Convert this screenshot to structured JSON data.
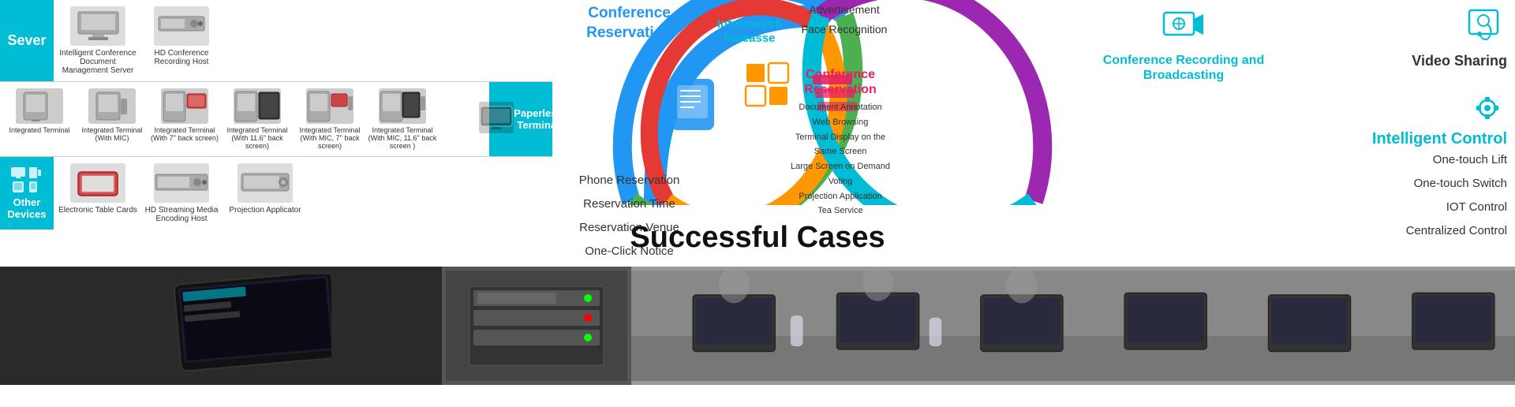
{
  "server": {
    "label": "Sever",
    "items": [
      {
        "name": "Intelligent Conference Document Management Server",
        "iconLabel": "Server"
      },
      {
        "name": "HD Conference Recording Host",
        "iconLabel": "Host"
      }
    ]
  },
  "terminals": {
    "items": [
      {
        "name": "Integrated Terminal",
        "iconLabel": "Terminal"
      },
      {
        "name": "Integrated Terminal (With MIC)",
        "iconLabel": "Terminal"
      },
      {
        "name": "Integrated Terminal (With 7'' back screen)",
        "iconLabel": "Screen"
      },
      {
        "name": "Integrated Terminal (With 11.6'' back screen)",
        "iconLabel": "Screen"
      },
      {
        "name": "Integrated Terminal (With MIC, 7'' back screen)",
        "iconLabel": "Screen"
      },
      {
        "name": "Integrated Terminal (With MIC, 11.6'' back screen )",
        "iconLabel": "Screen"
      }
    ],
    "paperless": {
      "label": "Paperless Terminal",
      "iconLabel": "Screen"
    }
  },
  "otherDevices": {
    "label": "Other Devices",
    "items": [
      {
        "name": "Electronic Table Cards",
        "iconLabel": "Card"
      },
      {
        "name": "HD Streaming Media Encoding Host",
        "iconLabel": "Host"
      },
      {
        "name": "Projection Applicator",
        "iconLabel": "Proj"
      }
    ]
  },
  "diagram": {
    "conferenceReservation": {
      "title": "Conference Reservation",
      "items": [
        "Phone Reservation",
        "Reservation Time",
        "Reservation Venue",
        "One-Click Notice"
      ]
    },
    "informationRelease": {
      "title": "Information Releasse"
    },
    "topCenter": {
      "lines": [
        "Advertisement",
        "Face Recognition"
      ]
    },
    "videoSharing": {
      "title": "Video Sharing"
    },
    "conferenceReservationCenter": {
      "title": "Conference\nReservation",
      "items": [
        "Document Annotation",
        "Web Browsing",
        "Terminal Display on the Same Screen",
        "Large Screen on Demand",
        "Voting",
        "Projection Application",
        "Tea Service"
      ]
    },
    "conferenceRecording": {
      "title": "Conference Recording and Broadcasting"
    },
    "intelligentControl": {
      "title": "Intelligent Control",
      "items": [
        "One-touch Lift",
        "One-touch Switch",
        "IOT Control",
        "Centralized Control"
      ]
    }
  },
  "successfulCases": {
    "title": "Successful Cases"
  },
  "colors": {
    "teal": "#00bcd4",
    "blue": "#2196F3",
    "pink": "#e91e63",
    "orange": "#ff9800",
    "purple": "#9c27b0",
    "green": "#4caf50"
  }
}
